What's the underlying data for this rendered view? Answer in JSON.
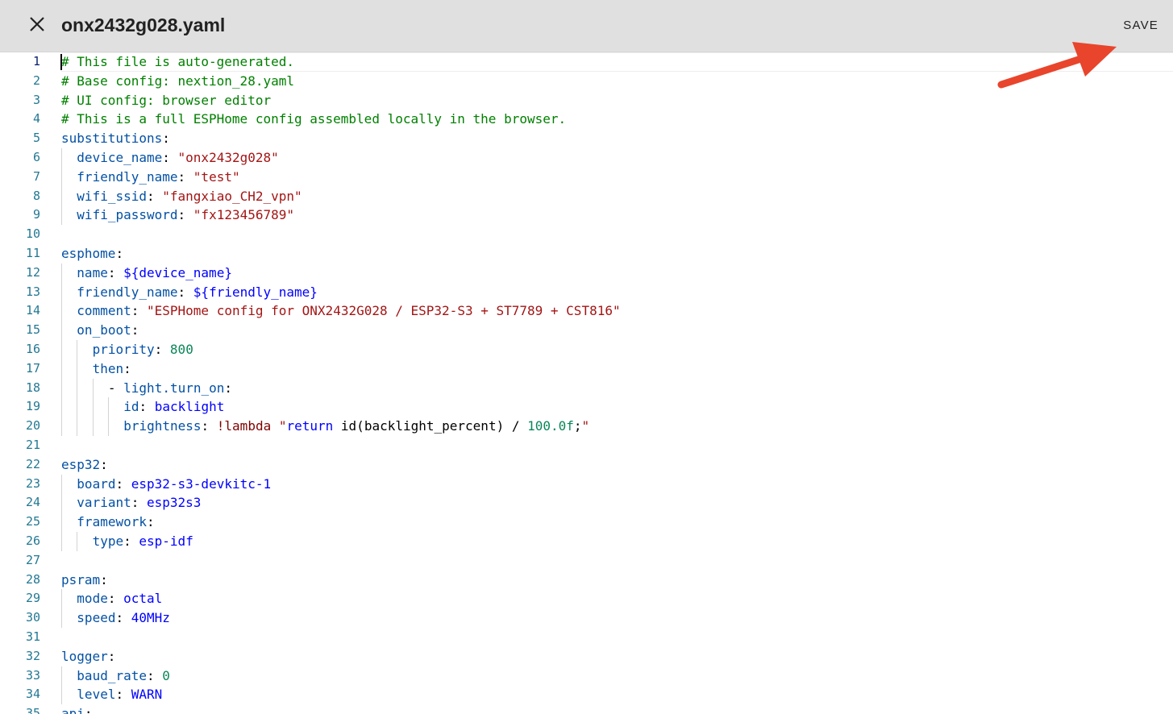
{
  "dialog": {
    "title": "onx2432g028.yaml",
    "save_label": "SAVE",
    "close_icon": "close-icon",
    "arrow_color": "#e8452c"
  },
  "editor": {
    "lines": [
      {
        "n": "1",
        "indent": 0,
        "tokens": [
          {
            "t": "# This file is auto-generated.",
            "c": "comment"
          }
        ]
      },
      {
        "n": "2",
        "indent": 0,
        "tokens": [
          {
            "t": "# Base config: nextion_28.yaml",
            "c": "comment"
          }
        ]
      },
      {
        "n": "3",
        "indent": 0,
        "tokens": [
          {
            "t": "# UI config: browser editor",
            "c": "comment"
          }
        ]
      },
      {
        "n": "4",
        "indent": 0,
        "tokens": [
          {
            "t": "# This is a full ESPHome config assembled locally in the browser.",
            "c": "comment"
          }
        ]
      },
      {
        "n": "5",
        "indent": 0,
        "tokens": [
          {
            "t": "substitutions",
            "c": "key"
          },
          {
            "t": ":",
            "c": "punc"
          }
        ]
      },
      {
        "n": "6",
        "indent": 1,
        "tokens": [
          {
            "t": "device_name",
            "c": "key"
          },
          {
            "t": ": ",
            "c": "punc"
          },
          {
            "t": "\"onx2432g028\"",
            "c": "string"
          }
        ]
      },
      {
        "n": "7",
        "indent": 1,
        "tokens": [
          {
            "t": "friendly_name",
            "c": "key"
          },
          {
            "t": ": ",
            "c": "punc"
          },
          {
            "t": "\"test\"",
            "c": "string"
          }
        ]
      },
      {
        "n": "8",
        "indent": 1,
        "tokens": [
          {
            "t": "wifi_ssid",
            "c": "key"
          },
          {
            "t": ": ",
            "c": "punc"
          },
          {
            "t": "\"fangxiao_CH2_vpn\"",
            "c": "string"
          }
        ]
      },
      {
        "n": "9",
        "indent": 1,
        "tokens": [
          {
            "t": "wifi_password",
            "c": "key"
          },
          {
            "t": ": ",
            "c": "punc"
          },
          {
            "t": "\"fx123456789\"",
            "c": "string"
          }
        ]
      },
      {
        "n": "10",
        "indent": 0,
        "tokens": []
      },
      {
        "n": "11",
        "indent": 0,
        "tokens": [
          {
            "t": "esphome",
            "c": "key"
          },
          {
            "t": ":",
            "c": "punc"
          }
        ]
      },
      {
        "n": "12",
        "indent": 1,
        "tokens": [
          {
            "t": "name",
            "c": "key"
          },
          {
            "t": ": ",
            "c": "punc"
          },
          {
            "t": "${device_name}",
            "c": "plain"
          }
        ]
      },
      {
        "n": "13",
        "indent": 1,
        "tokens": [
          {
            "t": "friendly_name",
            "c": "key"
          },
          {
            "t": ": ",
            "c": "punc"
          },
          {
            "t": "${friendly_name}",
            "c": "plain"
          }
        ]
      },
      {
        "n": "14",
        "indent": 1,
        "tokens": [
          {
            "t": "comment",
            "c": "key"
          },
          {
            "t": ": ",
            "c": "punc"
          },
          {
            "t": "\"ESPHome config for ONX2432G028 / ESP32-S3 + ST7789 + CST816\"",
            "c": "string"
          }
        ]
      },
      {
        "n": "15",
        "indent": 1,
        "tokens": [
          {
            "t": "on_boot",
            "c": "key"
          },
          {
            "t": ":",
            "c": "punc"
          }
        ]
      },
      {
        "n": "16",
        "indent": 2,
        "tokens": [
          {
            "t": "priority",
            "c": "key"
          },
          {
            "t": ": ",
            "c": "punc"
          },
          {
            "t": "800",
            "c": "number"
          }
        ]
      },
      {
        "n": "17",
        "indent": 2,
        "tokens": [
          {
            "t": "then",
            "c": "key"
          },
          {
            "t": ":",
            "c": "punc"
          }
        ]
      },
      {
        "n": "18",
        "indent": 3,
        "tokens": [
          {
            "t": "- ",
            "c": "punc"
          },
          {
            "t": "light.turn_on",
            "c": "key"
          },
          {
            "t": ":",
            "c": "punc"
          }
        ]
      },
      {
        "n": "19",
        "indent": 4,
        "tokens": [
          {
            "t": "id",
            "c": "key"
          },
          {
            "t": ": ",
            "c": "punc"
          },
          {
            "t": "backlight",
            "c": "plain"
          }
        ]
      },
      {
        "n": "20",
        "indent": 4,
        "tokens": [
          {
            "t": "brightness",
            "c": "key"
          },
          {
            "t": ": ",
            "c": "punc"
          },
          {
            "t": "!lambda",
            "c": "tag"
          },
          {
            "t": " \"",
            "c": "string"
          },
          {
            "t": "return",
            "c": "plain"
          },
          {
            "t": " id(backlight_percent) / ",
            "c": "punc"
          },
          {
            "t": "100.0f",
            "c": "number"
          },
          {
            "t": ";",
            "c": "punc"
          },
          {
            "t": "\"",
            "c": "string"
          }
        ]
      },
      {
        "n": "21",
        "indent": 0,
        "tokens": []
      },
      {
        "n": "22",
        "indent": 0,
        "tokens": [
          {
            "t": "esp32",
            "c": "key"
          },
          {
            "t": ":",
            "c": "punc"
          }
        ]
      },
      {
        "n": "23",
        "indent": 1,
        "tokens": [
          {
            "t": "board",
            "c": "key"
          },
          {
            "t": ": ",
            "c": "punc"
          },
          {
            "t": "esp32-s3-devkitc-1",
            "c": "plain"
          }
        ]
      },
      {
        "n": "24",
        "indent": 1,
        "tokens": [
          {
            "t": "variant",
            "c": "key"
          },
          {
            "t": ": ",
            "c": "punc"
          },
          {
            "t": "esp32s3",
            "c": "plain"
          }
        ]
      },
      {
        "n": "25",
        "indent": 1,
        "tokens": [
          {
            "t": "framework",
            "c": "key"
          },
          {
            "t": ":",
            "c": "punc"
          }
        ]
      },
      {
        "n": "26",
        "indent": 2,
        "tokens": [
          {
            "t": "type",
            "c": "key"
          },
          {
            "t": ": ",
            "c": "punc"
          },
          {
            "t": "esp-idf",
            "c": "plain"
          }
        ]
      },
      {
        "n": "27",
        "indent": 0,
        "tokens": []
      },
      {
        "n": "28",
        "indent": 0,
        "tokens": [
          {
            "t": "psram",
            "c": "key"
          },
          {
            "t": ":",
            "c": "punc"
          }
        ]
      },
      {
        "n": "29",
        "indent": 1,
        "tokens": [
          {
            "t": "mode",
            "c": "key"
          },
          {
            "t": ": ",
            "c": "punc"
          },
          {
            "t": "octal",
            "c": "plain"
          }
        ]
      },
      {
        "n": "30",
        "indent": 1,
        "tokens": [
          {
            "t": "speed",
            "c": "key"
          },
          {
            "t": ": ",
            "c": "punc"
          },
          {
            "t": "40MHz",
            "c": "plain"
          }
        ]
      },
      {
        "n": "31",
        "indent": 0,
        "tokens": []
      },
      {
        "n": "32",
        "indent": 0,
        "tokens": [
          {
            "t": "logger",
            "c": "key"
          },
          {
            "t": ":",
            "c": "punc"
          }
        ]
      },
      {
        "n": "33",
        "indent": 1,
        "tokens": [
          {
            "t": "baud_rate",
            "c": "key"
          },
          {
            "t": ": ",
            "c": "punc"
          },
          {
            "t": "0",
            "c": "number"
          }
        ]
      },
      {
        "n": "34",
        "indent": 1,
        "tokens": [
          {
            "t": "level",
            "c": "key"
          },
          {
            "t": ": ",
            "c": "punc"
          },
          {
            "t": "WARN",
            "c": "plain"
          }
        ]
      },
      {
        "n": "35",
        "indent": 0,
        "tokens": [
          {
            "t": "api",
            "c": "key"
          },
          {
            "t": ":",
            "c": "punc"
          }
        ]
      }
    ]
  }
}
